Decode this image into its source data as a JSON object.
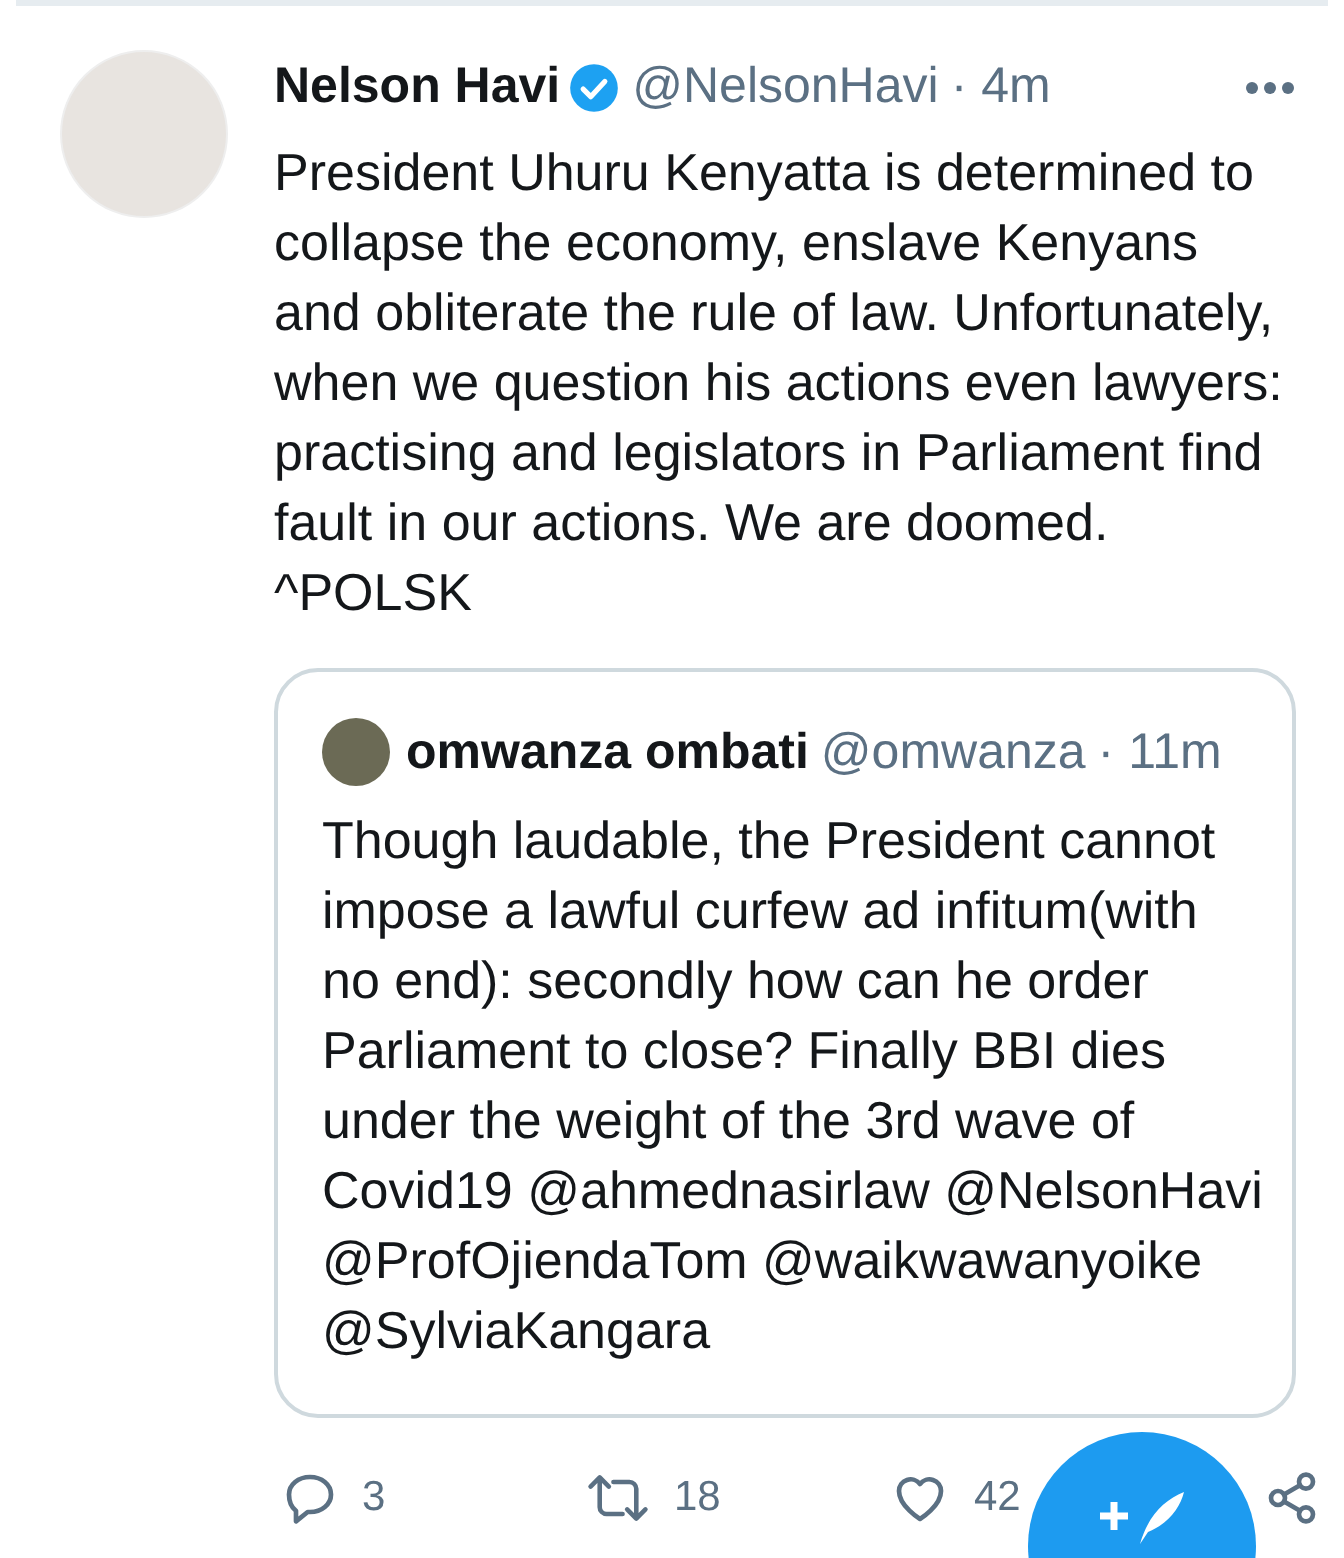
{
  "tweet": {
    "name": "Nelson Havi",
    "verified": true,
    "handle": "@NelsonHavi",
    "time": "· 4m",
    "text": "President Uhuru Kenyatta is determined to collapse the economy, enslave Kenyans and obliterate the rule of law. Unfortunately, when we question his actions even lawyers: practising and legislators in Parliament find fault in our actions. We are doomed.\n^POLSK"
  },
  "quoted_tweet": {
    "name": "omwanza ombati",
    "handle": "@omwanza",
    "time": "· 11m",
    "text": "Though laudable, the President cannot impose a lawful curfew ad infitum(with no end): secondly how can he order Parliament to close? Finally BBI dies under the weight of the 3rd wave of Covid19 @ahmednasirlaw @NelsonHavi @ProfOjiendaTom @waikwawanyoike @SylviaKangara"
  },
  "actions": [
    {
      "kind": "reply",
      "count": "3"
    },
    {
      "kind": "retweet",
      "count": "18"
    },
    {
      "kind": "like",
      "count": "42"
    },
    {
      "kind": "share"
    }
  ]
}
